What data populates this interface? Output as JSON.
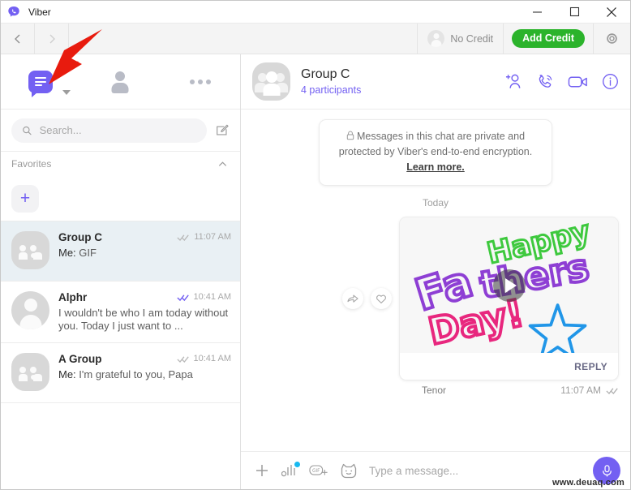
{
  "window": {
    "app_name": "Viber",
    "logo_icon": "viber-logo-icon",
    "minimize_label": "—",
    "maximize_label": "□",
    "close_label": "✕"
  },
  "toolbar": {
    "back_icon": "chevron-left-icon",
    "forward_icon": "chevron-right-icon",
    "credit_status": "No Credit",
    "add_credit_label": "Add Credit",
    "settings_icon": "gear-icon",
    "avatar_icon": "user-avatar-icon"
  },
  "sidebar": {
    "nav": [
      {
        "name": "chats",
        "icon": "chat-bubble-icon",
        "active": true
      },
      {
        "name": "contacts",
        "icon": "contact-icon",
        "active": false
      },
      {
        "name": "more",
        "icon": "more-dots-icon",
        "active": false
      }
    ],
    "search": {
      "placeholder": "Search...",
      "value": "",
      "icon": "search-icon",
      "compose_icon": "compose-icon"
    },
    "favorites": {
      "label": "Favorites",
      "collapse_icon": "chevron-up-icon",
      "add_label": "+"
    },
    "chats": [
      {
        "name": "Group C",
        "preview_prefix": "Me:",
        "preview": "GIF",
        "time": "11:07 AM",
        "status": "delivered",
        "avatar": "group-avatar",
        "active": true
      },
      {
        "name": "Alphr",
        "preview_prefix": "",
        "preview": "I wouldn't be who I am today without you. Today I just want to ...",
        "time": "10:41 AM",
        "status": "read",
        "avatar": "person-avatar",
        "active": false
      },
      {
        "name": "A Group",
        "preview_prefix": "Me:",
        "preview": "I'm grateful to you, Papa",
        "time": "10:41 AM",
        "status": "delivered",
        "avatar": "group-avatar",
        "active": false
      }
    ]
  },
  "conversation": {
    "title": "Group C",
    "subtitle": "4 participants",
    "avatar": "group-avatar",
    "actions": [
      {
        "name": "add-participant",
        "icon": "add-person-icon"
      },
      {
        "name": "voice-call",
        "icon": "phone-icon"
      },
      {
        "name": "video-call",
        "icon": "video-camera-icon"
      },
      {
        "name": "chat-info",
        "icon": "info-icon"
      }
    ],
    "encryption_notice": {
      "lock_icon": "lock-icon",
      "text": "Messages in this chat are private and protected by Viber's end-to-end encryption.",
      "link": "Learn more."
    },
    "day_separator": "Today",
    "messages": [
      {
        "type": "gif",
        "source": "Tenor",
        "time": "11:07 AM",
        "status": "delivered",
        "reply_label": "REPLY",
        "play_icon": "play-icon",
        "forward_icon": "forward-icon",
        "like_icon": "heart-icon",
        "art": {
          "line1": "Happy",
          "line2": "Fathers",
          "line3": "Day!",
          "star": "star-shape"
        }
      }
    ]
  },
  "composer": {
    "placeholder": "Type a message...",
    "value": "",
    "icons": [
      {
        "name": "attach-plus-icon",
        "label": "+"
      },
      {
        "name": "audio-bars-icon",
        "badge": true
      },
      {
        "name": "gif-icon",
        "label": "GIF"
      },
      {
        "name": "sticker-icon"
      }
    ],
    "mic_icon": "microphone-icon"
  },
  "watermark": "www.deuaq.com",
  "annotation": {
    "arrow_icon": "red-arrow-annotation",
    "color": "#e81b0e"
  },
  "colors": {
    "brand_purple": "#7360f2",
    "green_button": "#2bb32b",
    "active_chat_bg": "#e9f0f4",
    "read_check": "#7360f2",
    "delivered_check": "#b8b8b8"
  }
}
